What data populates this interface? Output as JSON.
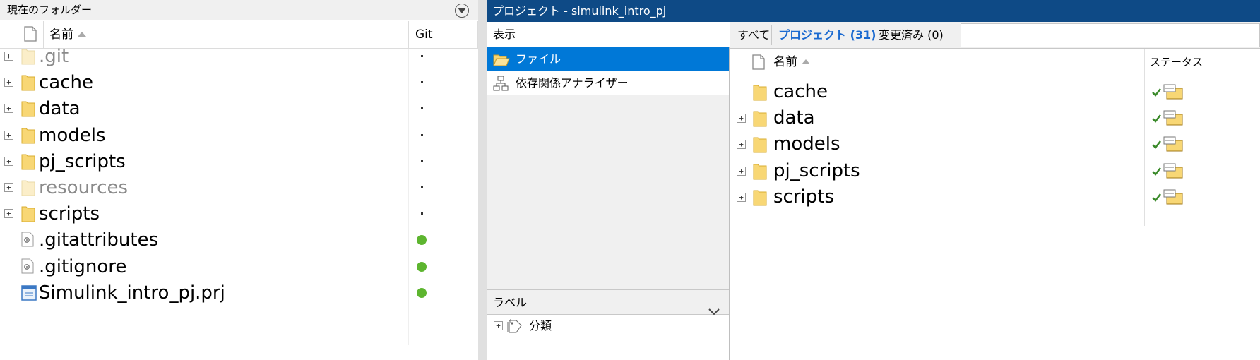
{
  "left_panel": {
    "title": "現在のフォルダー",
    "columns": {
      "name": "名前",
      "git": "Git"
    },
    "rows": [
      {
        "name": ".git",
        "kind": "folder",
        "dim": true,
        "expandable": true,
        "git": "dot"
      },
      {
        "name": "cache",
        "kind": "folder",
        "dim": false,
        "expandable": true,
        "git": "dot"
      },
      {
        "name": "data",
        "kind": "folder",
        "dim": false,
        "expandable": true,
        "git": "dot"
      },
      {
        "name": "models",
        "kind": "folder",
        "dim": false,
        "expandable": true,
        "git": "dot"
      },
      {
        "name": "pj_scripts",
        "kind": "folder",
        "dim": false,
        "expandable": true,
        "git": "dot"
      },
      {
        "name": "resources",
        "kind": "folder",
        "dim": true,
        "expandable": true,
        "git": "dot"
      },
      {
        "name": "scripts",
        "kind": "folder",
        "dim": false,
        "expandable": true,
        "git": "dot"
      },
      {
        "name": ".gitattributes",
        "kind": "file",
        "dim": false,
        "expandable": false,
        "git": "green"
      },
      {
        "name": ".gitignore",
        "kind": "file",
        "dim": false,
        "expandable": false,
        "git": "green"
      },
      {
        "name": "Simulink_intro_pj.prj",
        "kind": "project",
        "dim": false,
        "expandable": false,
        "git": "green"
      }
    ]
  },
  "project_window": {
    "title": "プロジェクト - simulink_intro_pj",
    "nav": {
      "header": "表示",
      "items": [
        {
          "label": "ファイル",
          "icon": "open-folder-icon",
          "selected": true
        },
        {
          "label": "依存関係アナライザー",
          "icon": "hierarchy-icon",
          "selected": false
        }
      ],
      "label_section": {
        "header": "ラベル",
        "item": "分類"
      }
    },
    "tabs": [
      {
        "label": "すべて",
        "active": false
      },
      {
        "label": "プロジェクト (31)",
        "active": true
      },
      {
        "label": "変更済み (0)",
        "active": false
      }
    ],
    "search_placeholder": "",
    "columns": {
      "name": "名前",
      "status": "ステータス"
    },
    "rows": [
      {
        "name": "cache",
        "expandable": false
      },
      {
        "name": "data",
        "expandable": true
      },
      {
        "name": "models",
        "expandable": true
      },
      {
        "name": "pj_scripts",
        "expandable": true
      },
      {
        "name": "scripts",
        "expandable": true
      }
    ]
  },
  "colors": {
    "title_bar": "#0e4a86",
    "selection": "#0078d7",
    "folder": "#f8d775",
    "git_green": "#5db52f",
    "active_tab": "#1b6ad0"
  }
}
